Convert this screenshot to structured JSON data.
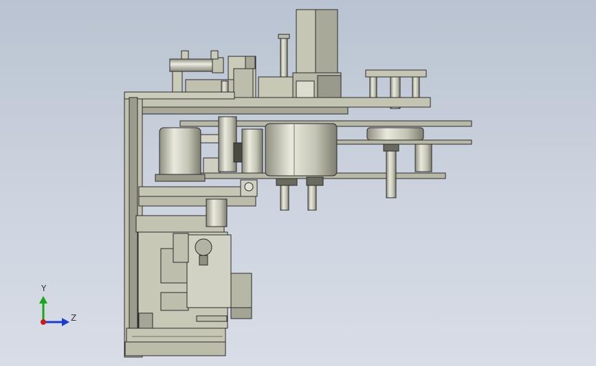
{
  "viewport": {
    "background_top": "#b9c3d1",
    "background_bottom": "#d8dde6"
  },
  "triad": {
    "y_label": "Y",
    "z_label": "Z",
    "y_color": "#1aa51a",
    "z_color": "#1a3ad6",
    "x_color": "#d01818"
  },
  "model": {
    "part_color": "#cbcbb9",
    "edge_color": "#2a2a2a",
    "shade_color": "#9c9c8c",
    "dark_color": "#6f6f63"
  }
}
